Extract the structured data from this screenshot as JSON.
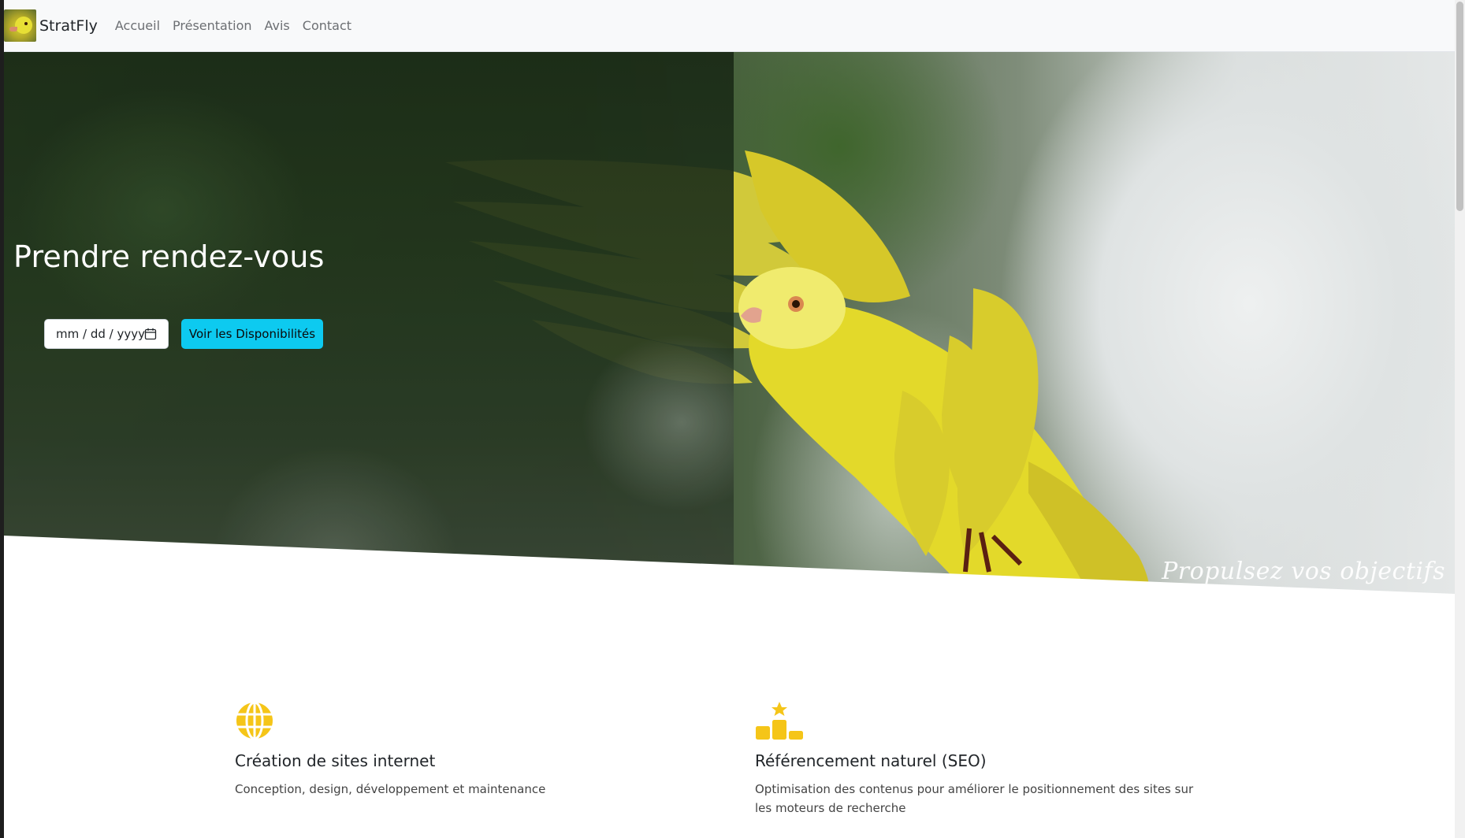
{
  "brand": {
    "name": "StratFly",
    "logo_icon": "yellow-bird-logo"
  },
  "nav": {
    "items": [
      {
        "label": "Accueil"
      },
      {
        "label": "Présentation"
      },
      {
        "label": "Avis"
      },
      {
        "label": "Contact"
      }
    ]
  },
  "hero": {
    "title": "Prendre rendez-vous",
    "date_input": {
      "value": "mm / dd / yyyy",
      "icon": "calendar-icon"
    },
    "button_label": "Voir les Disponibilités",
    "tagline": "Propulsez vos objectifs",
    "colors": {
      "button": "#0dcaf0",
      "bird": "#e3d92a"
    }
  },
  "services": [
    {
      "icon": "globe-icon",
      "title": "Création de sites internet",
      "description": "Conception, design, développement et maintenance"
    },
    {
      "icon": "podium-icon",
      "title": "Référencement naturel (SEO)",
      "description": "Optimisation des contenus pour améliorer le positionnement des sites sur les moteurs de recherche"
    }
  ],
  "accent_color": "#f5c518"
}
